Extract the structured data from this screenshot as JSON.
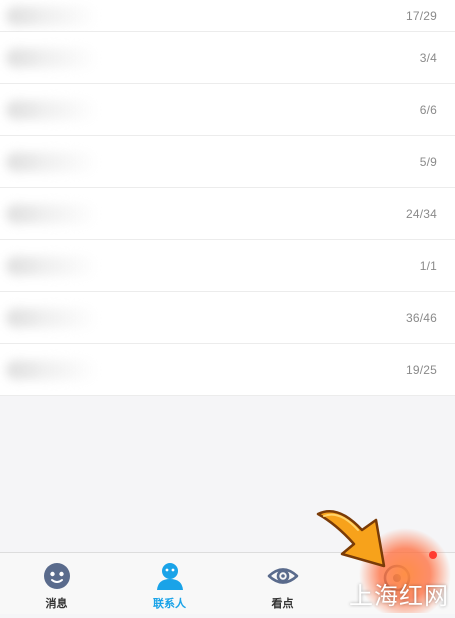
{
  "contacts": {
    "groups": [
      {
        "count": "17/29"
      },
      {
        "count": "3/4"
      },
      {
        "count": "6/6"
      },
      {
        "count": "5/9"
      },
      {
        "count": "24/34"
      },
      {
        "count": "1/1"
      },
      {
        "count": "36/46"
      },
      {
        "count": "19/25"
      }
    ]
  },
  "tabbar": {
    "messages": "消息",
    "contacts": "联系人",
    "kandian": "看点",
    "active_color": "#1aa3e8"
  },
  "watermark": "上海红网"
}
